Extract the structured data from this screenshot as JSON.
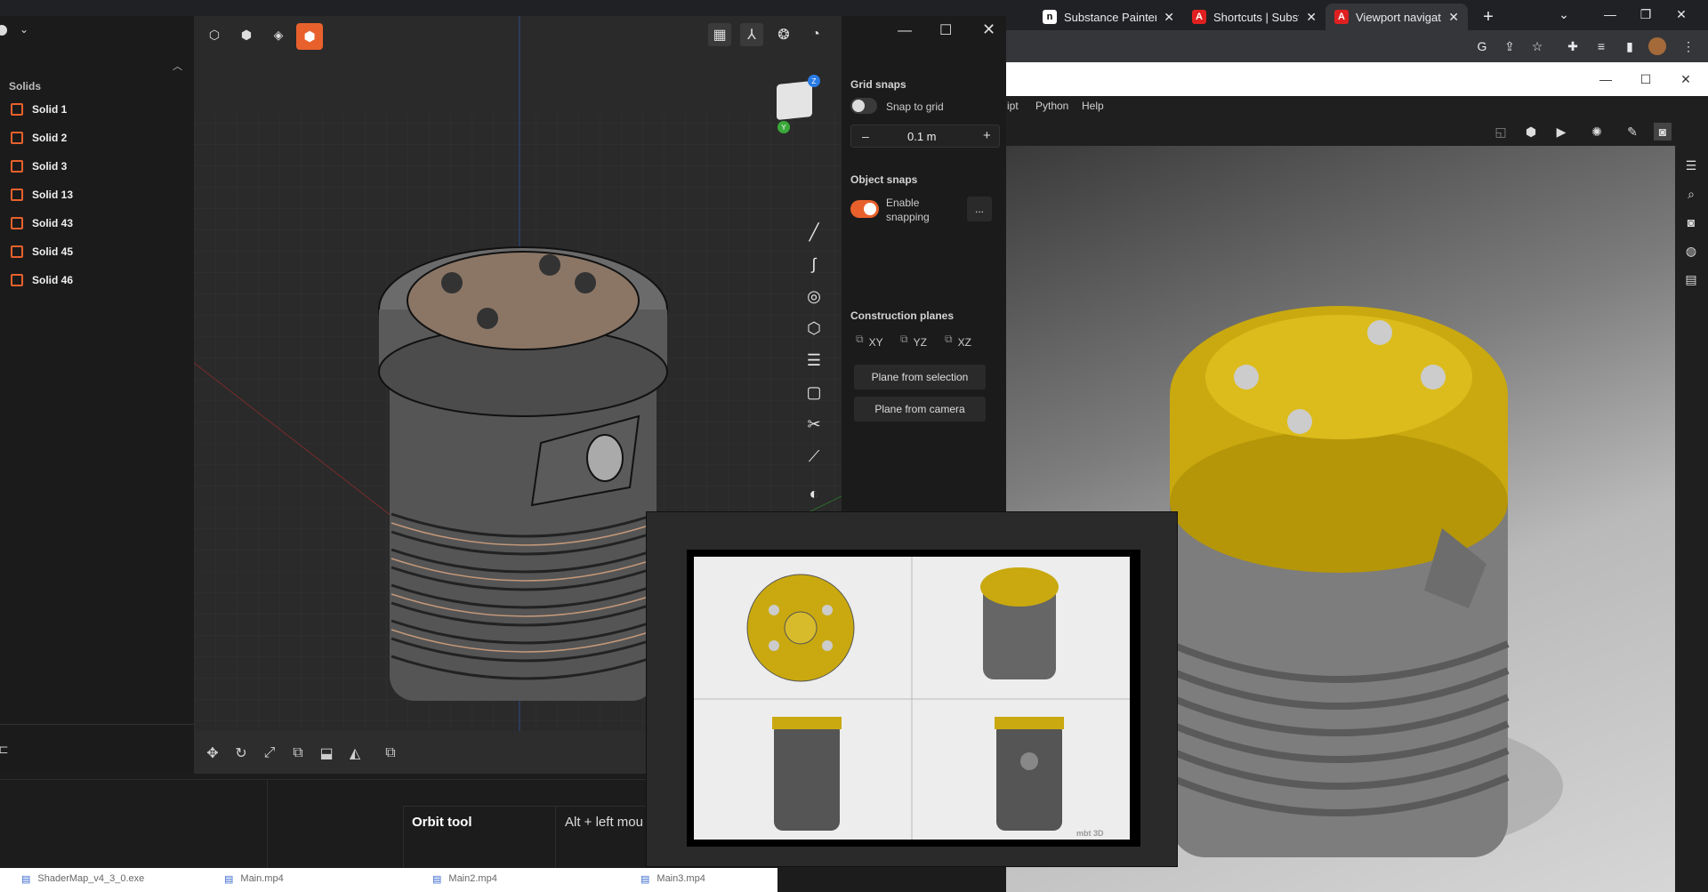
{
  "browser": {
    "tabs": [
      {
        "label": "Substance Painter",
        "favicon": "n",
        "active": false
      },
      {
        "label": "Shortcuts | Substan",
        "favicon": "A",
        "active": false
      },
      {
        "label": "Viewport navigatio",
        "favicon": "A",
        "active": true
      }
    ],
    "new_tab": "+"
  },
  "substance": {
    "menu": [
      "ipt",
      "Python",
      "Help"
    ]
  },
  "plasticity": {
    "solids_header": "Solids",
    "solids": [
      "Solid 1",
      "Solid 2",
      "Solid 3",
      "Solid 13",
      "Solid 43",
      "Solid 45",
      "Solid 46"
    ],
    "view_cube": {
      "z_label": "Z",
      "y_label": "Y"
    },
    "grid_snaps": {
      "title": "Grid snaps",
      "snap_to_grid_label": "Snap to grid",
      "snap_to_grid_on": false,
      "value": "0.1 m",
      "minus": "–",
      "plus": "+"
    },
    "object_snaps": {
      "title": "Object snaps",
      "enable_label": "Enable snapping",
      "enabled": true,
      "more": "..."
    },
    "construction_planes": {
      "title": "Construction planes",
      "planes": [
        "XY",
        "YZ",
        "XZ"
      ],
      "from_selection": "Plane from selection",
      "from_camera": "Plane from camera"
    },
    "accent": "#e8612c"
  },
  "shortcuts": {
    "tool": "Orbit tool",
    "shortcut": "Alt + left mou"
  },
  "downloads": [
    "ShaderMap_v4_3_0.exe",
    "Main.mp4",
    "Main2.mp4",
    "Main3.mp4"
  ],
  "popup": {
    "watermark": "mbt 3D"
  }
}
